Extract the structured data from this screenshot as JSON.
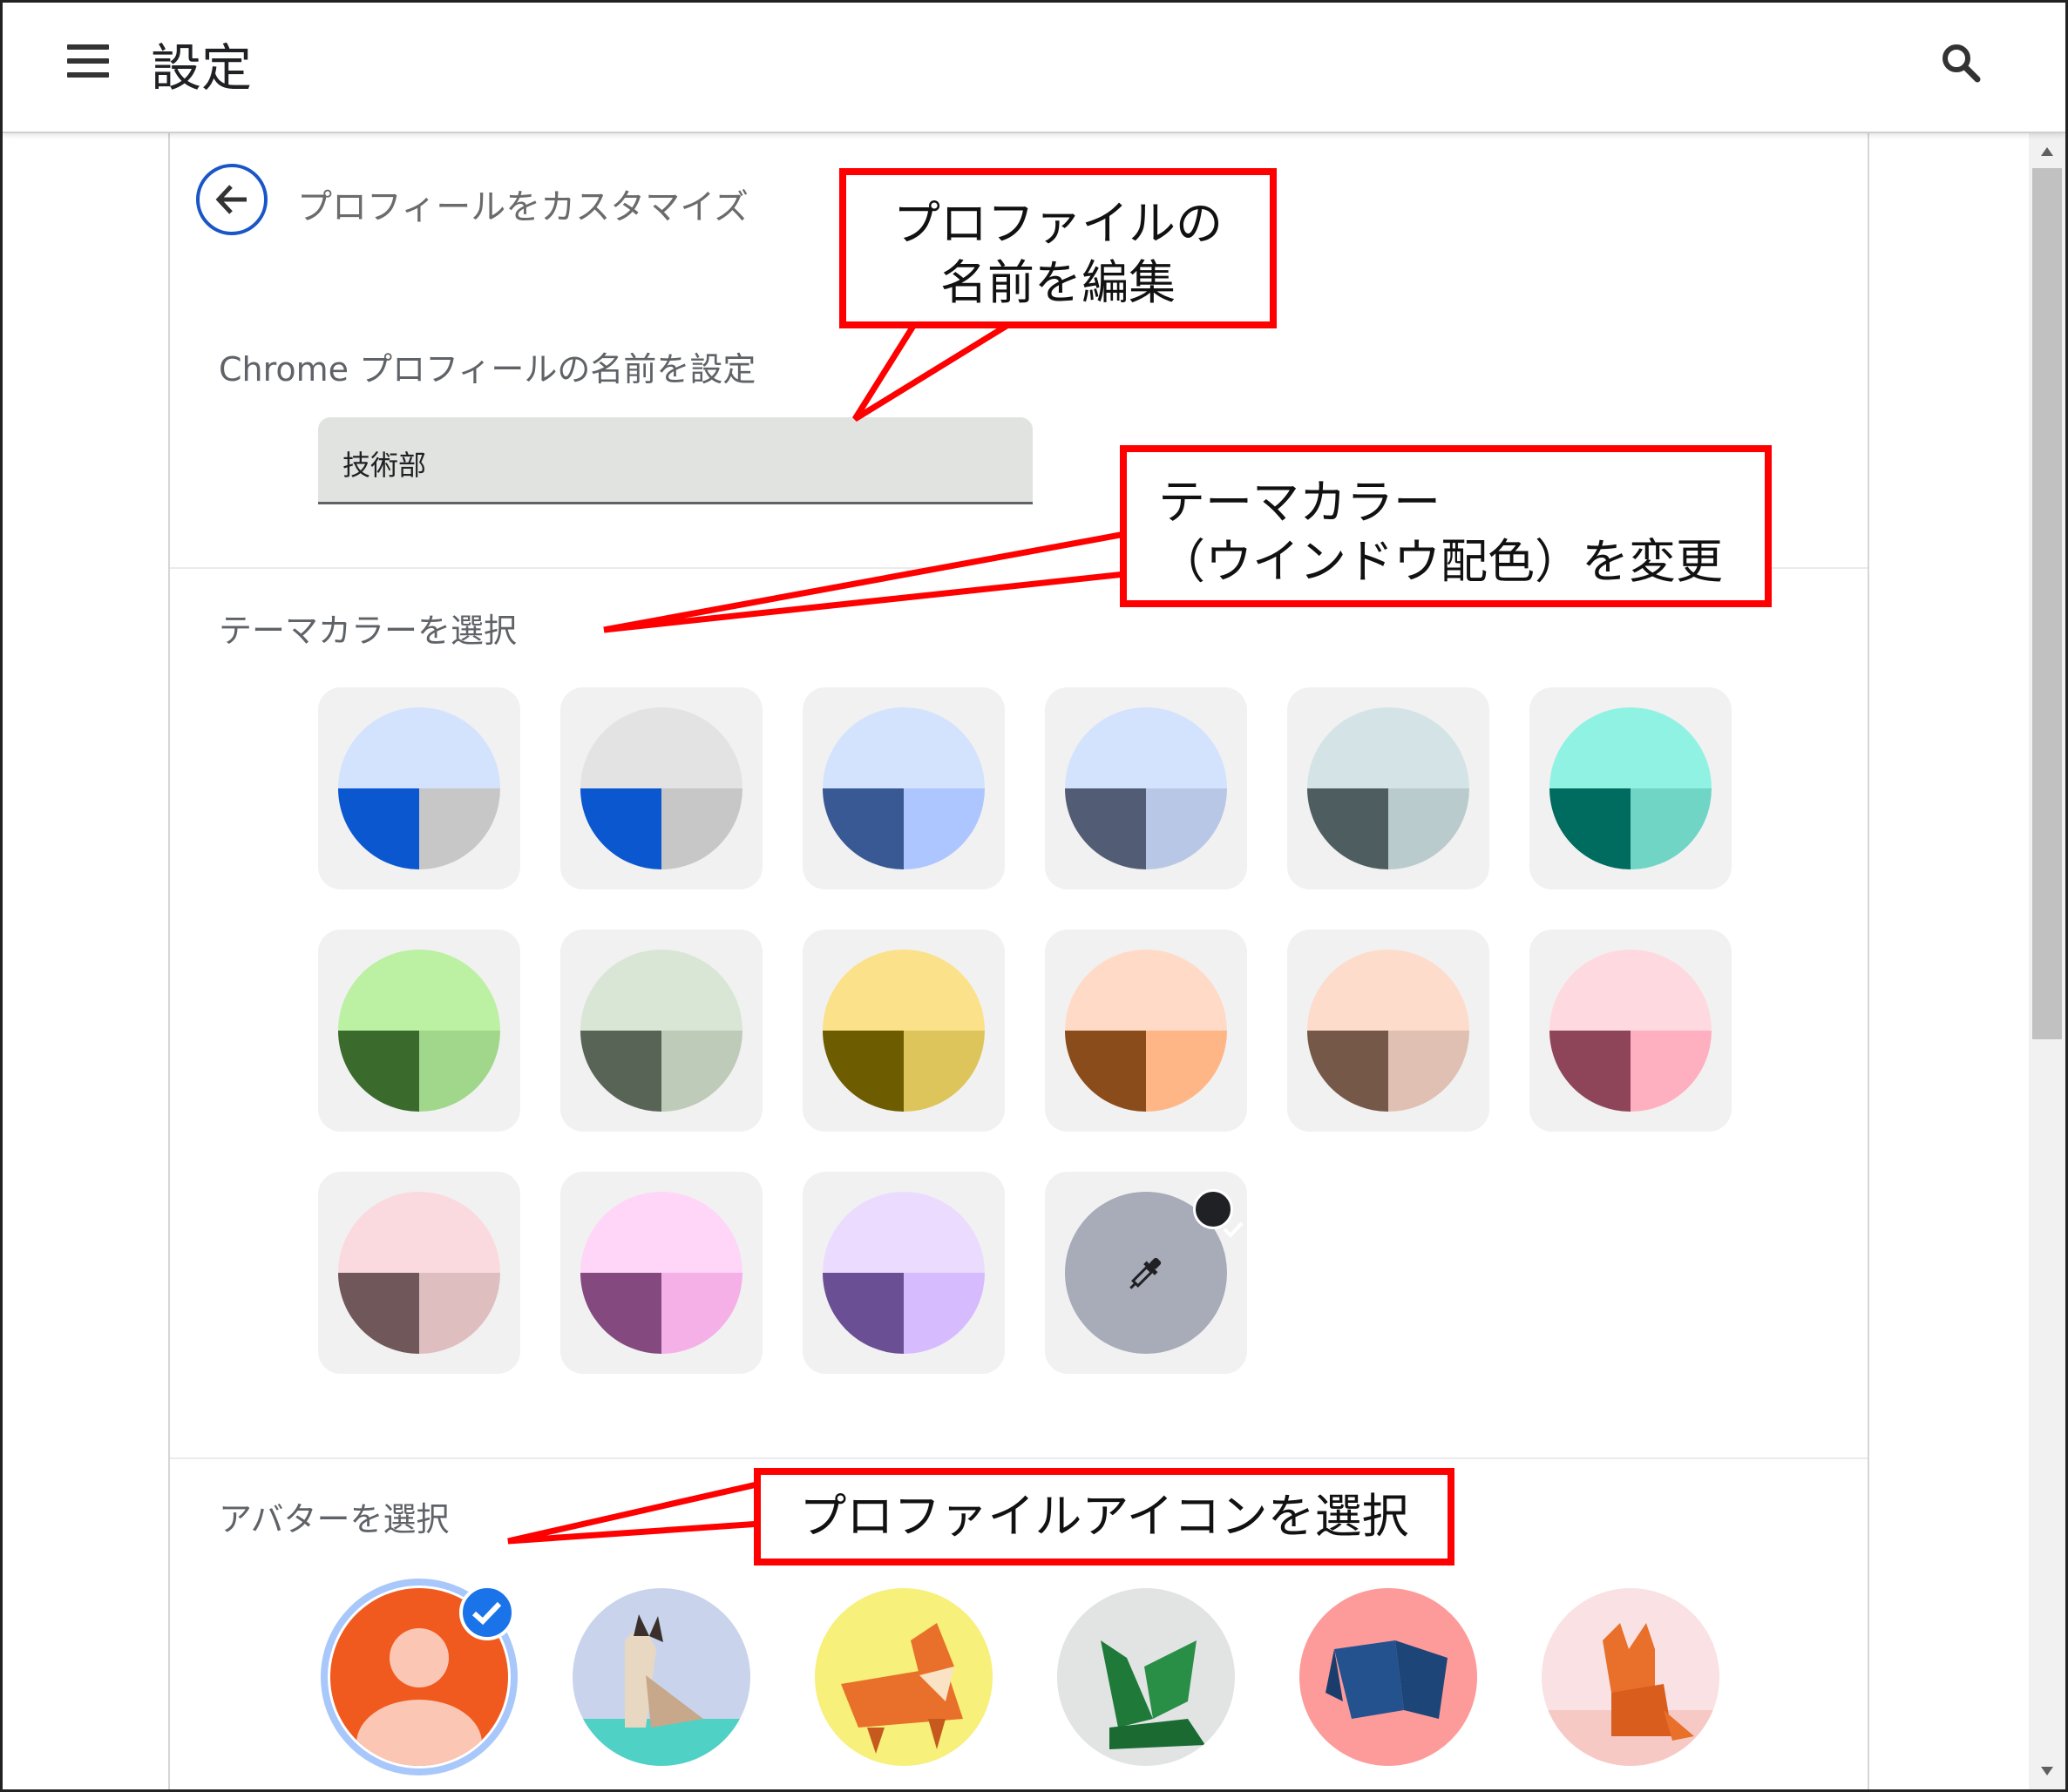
{
  "header": {
    "title": "設定"
  },
  "panel": {
    "subtitle": "プロフィールをカスタマイズ",
    "name_label": "Chrome プロフィールの名前を設定",
    "name_value": "技術部",
    "theme_label": "テーマカラーを選択",
    "avatar_label": "アバターを選択"
  },
  "themes": [
    {
      "top": "#d3e3fd",
      "left": "#0b57d0",
      "right": "#c7c7c7"
    },
    {
      "top": "#e3e3e3",
      "left": "#0b57d0",
      "right": "#c7c7c7"
    },
    {
      "top": "#d3e3fd",
      "left": "#395994",
      "right": "#adc6ff"
    },
    {
      "top": "#d3e3fd",
      "left": "#525d75",
      "right": "#b9c7e6"
    },
    {
      "top": "#d4e4e6",
      "left": "#4e5e60",
      "right": "#b9cbcd"
    },
    {
      "top": "#90f2e3",
      "left": "#006b5f",
      "right": "#70d5c5"
    },
    {
      "top": "#bcf0a3",
      "left": "#3a6a2c",
      "right": "#a1d78b"
    },
    {
      "top": "#dae6d5",
      "left": "#586455",
      "right": "#bfcbb9"
    },
    {
      "top": "#fbe18a",
      "left": "#6e5d00",
      "right": "#ddc55c"
    },
    {
      "top": "#ffdbc7",
      "left": "#8b4c1b",
      "right": "#ffb687"
    },
    {
      "top": "#fddccc",
      "left": "#765849",
      "right": "#e0c0b2"
    },
    {
      "top": "#ffd9e0",
      "left": "#8f4559",
      "right": "#ffb0c0"
    },
    {
      "top": "#fbdadf",
      "left": "#705759",
      "right": "#dfbec0"
    },
    {
      "top": "#ffd6f7",
      "left": "#844a7f",
      "right": "#f5b0e8"
    },
    {
      "top": "#ebdcff",
      "left": "#6b4f95",
      "right": "#d6bbff"
    },
    {
      "custom": true,
      "color": "#a8abb8",
      "selected": true,
      "icon": "eyedropper-icon"
    }
  ],
  "avatars": [
    {
      "name": "default-person",
      "bg": "#f05a1e",
      "selected": true
    },
    {
      "name": "origami-cat",
      "bg": "#c9d4ec"
    },
    {
      "name": "origami-corgi",
      "bg": "#f7f07a"
    },
    {
      "name": "origami-dragon",
      "bg": "#e2e4e4"
    },
    {
      "name": "origami-elephant",
      "bg": "#fd9b9b"
    },
    {
      "name": "origami-fox",
      "bg": "#f9e1e4"
    }
  ],
  "callouts": {
    "edit_name": "プロファイルの\n名前を編集",
    "theme_change": "テーマカラー\n（ウインドウ配色）を変更",
    "pick_icon": "プロファイルアイコンを選択"
  },
  "colors": {
    "accent": "#1a56c7",
    "callout_border": "#ff0000",
    "check_blue": "#1a73e8"
  }
}
